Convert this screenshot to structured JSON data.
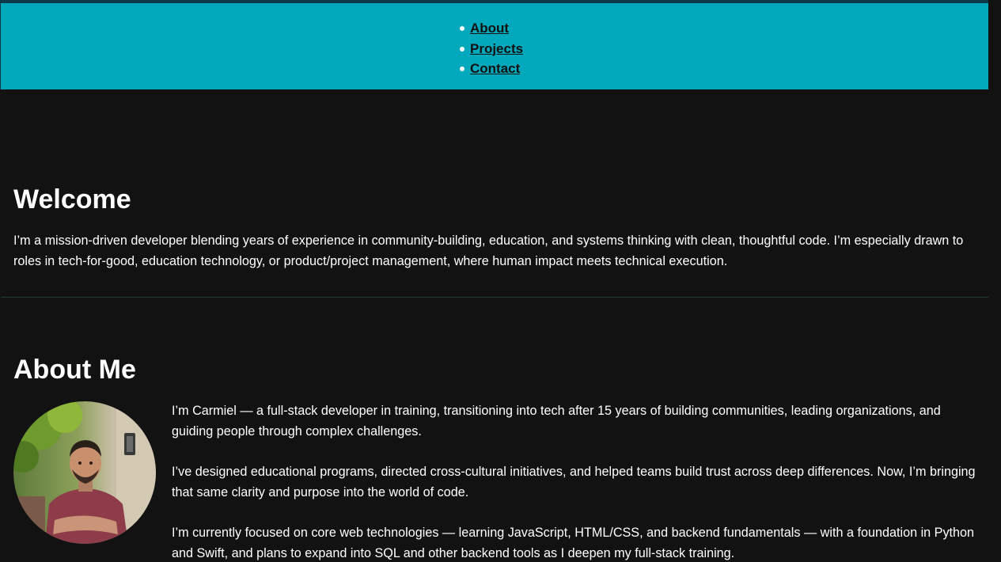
{
  "nav": {
    "items": [
      {
        "label": "About"
      },
      {
        "label": "Projects"
      },
      {
        "label": "Contact"
      }
    ]
  },
  "welcome": {
    "title": "Welcome",
    "text": "I’m a mission-driven developer blending years of experience in community-building, education, and systems thinking with clean, thoughtful code. I’m especially drawn to roles in tech-for-good, education technology, or product/project management, where human impact meets technical execution."
  },
  "about": {
    "title": "About Me",
    "paragraphs": [
      "I’m Carmiel — a full-stack developer in training, transitioning into tech after 15 years of building communities, leading organizations, and guiding people through complex challenges.",
      "I’ve designed educational programs, directed cross-cultural initiatives, and helped teams build trust across deep differences. Now, I’m bringing that same clarity and purpose into the world of code.",
      "I’m currently focused on core web technologies — learning JavaScript, HTML/CSS, and backend fundamentals — with a foundation in Python and Swift, and plans to expand into SQL and other backend tools as I deepen my full-stack training."
    ]
  },
  "colors": {
    "background": "#121212",
    "nav_bar": "#02a8bb",
    "text": "#ffffff",
    "nav_link": "#111111"
  }
}
